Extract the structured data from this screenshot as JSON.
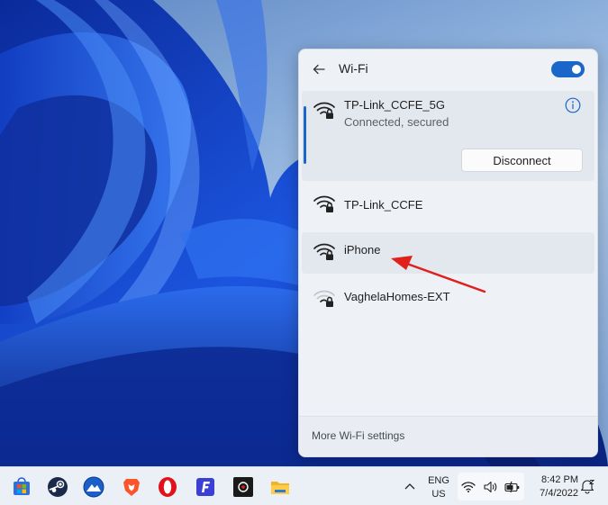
{
  "wifi_panel": {
    "title": "Wi-Fi",
    "toggle_state": "on",
    "networks": [
      {
        "name": "TP-Link_CCFE_5G",
        "status": "Connected, secured",
        "secured": true,
        "signal": "full",
        "connected": true
      },
      {
        "name": "TP-Link_CCFE",
        "secured": true,
        "signal": "full",
        "connected": false
      },
      {
        "name": "iPhone",
        "secured": true,
        "signal": "full",
        "connected": false,
        "highlighted": true
      },
      {
        "name": "VaghelaHomes-EXT",
        "secured": true,
        "signal": "weak",
        "connected": false
      }
    ],
    "disconnect_label": "Disconnect",
    "footer_link": "More Wi-Fi settings"
  },
  "annotation": {
    "type": "arrow",
    "color": "#e0201c",
    "points_to": "iPhone"
  },
  "taskbar": {
    "apps": [
      {
        "name": "microsoft-store-icon"
      },
      {
        "name": "steam-icon"
      },
      {
        "name": "app-blue-circle-icon"
      },
      {
        "name": "brave-icon"
      },
      {
        "name": "opera-icon"
      },
      {
        "name": "f-app-icon"
      },
      {
        "name": "obs-icon"
      },
      {
        "name": "file-explorer-icon"
      }
    ],
    "language": {
      "line1": "ENG",
      "line2": "US"
    },
    "clock": {
      "time": "8:42 PM",
      "date": "7/4/2022"
    }
  },
  "colors": {
    "accent": "#1a66c9",
    "annotation": "#e0201c"
  }
}
